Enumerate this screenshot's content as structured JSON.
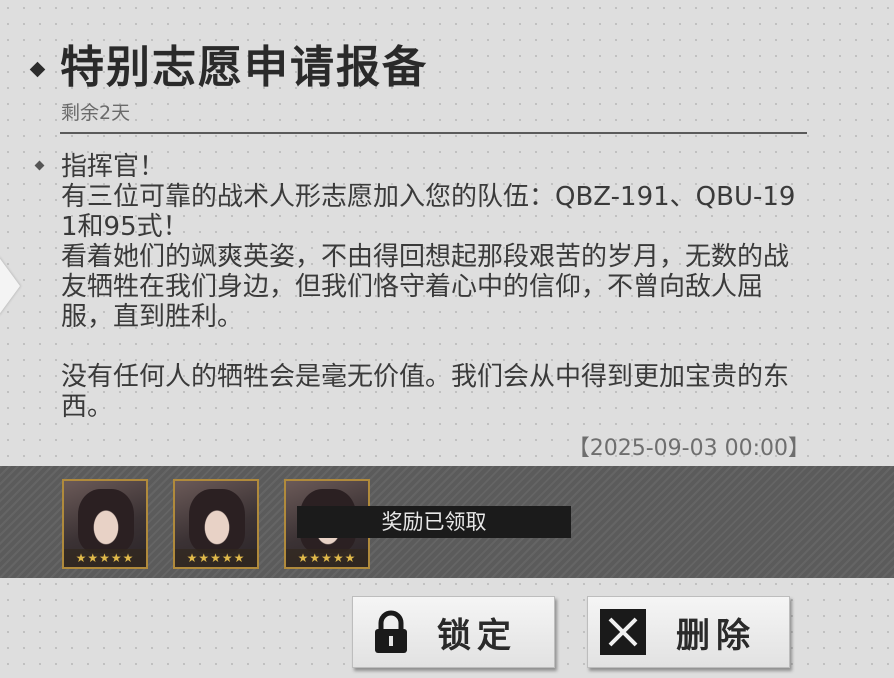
{
  "mail": {
    "title": "特别志愿申请报备",
    "remaining": "剩余2天",
    "body": {
      "line1": "指挥官！",
      "line2": "有三位可靠的战术人形志愿加入您的队伍：QBZ-191、QBU-191和95式！",
      "line3": "看着她们的飒爽英姿，不由得回想起那段艰苦的岁月，无数的战友牺牲在我们身边，但我们恪守着心中的信仰，不曾向敌人屈服，直到胜利。",
      "line4": "没有任何人的牺牲会是毫无价值。我们会从中得到更加宝贵的东西。"
    },
    "date": "【2025-09-03 00:00】"
  },
  "rewards": {
    "items": [
      {
        "name": "QBZ-191",
        "stars": "★★★★★"
      },
      {
        "name": "QBU-191",
        "stars": "★★★★★"
      },
      {
        "name": "95式",
        "stars": "★★★★★"
      }
    ],
    "claimed_label": "奖励已领取"
  },
  "actions": {
    "lock_label": "锁定",
    "delete_label": "删除"
  },
  "icons": {
    "lock": "lock-icon",
    "delete": "close-icon"
  },
  "colors": {
    "background": "#dedede",
    "reward_band": "#5b5b5b",
    "reward_frame": "#b08a3c",
    "claimed_bg": "#1b1b1b"
  }
}
